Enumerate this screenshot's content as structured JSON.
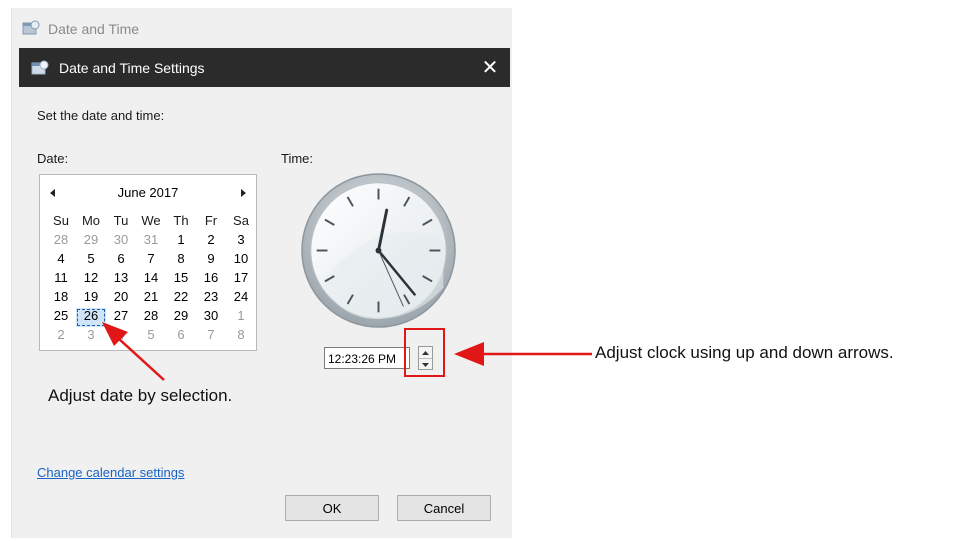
{
  "background_window": {
    "title": "Date and Time",
    "icon": "date-time-icon"
  },
  "dialog": {
    "title": "Date and Time Settings",
    "icon": "date-time-icon",
    "close_icon": "close-icon",
    "instruction": "Set the date and time:",
    "date_label": "Date:",
    "time_label": "Time:",
    "calendar": {
      "month_label": "June 2017",
      "weekdays": [
        "Su",
        "Mo",
        "Tu",
        "We",
        "Th",
        "Fr",
        "Sa"
      ],
      "weeks": [
        [
          "28",
          "29",
          "30",
          "31",
          "1",
          "2",
          "3"
        ],
        [
          "4",
          "5",
          "6",
          "7",
          "8",
          "9",
          "10"
        ],
        [
          "11",
          "12",
          "13",
          "14",
          "15",
          "16",
          "17"
        ],
        [
          "18",
          "19",
          "20",
          "21",
          "22",
          "23",
          "24"
        ],
        [
          "25",
          "26",
          "27",
          "28",
          "29",
          "30",
          "1"
        ],
        [
          "2",
          "3",
          "4",
          "5",
          "6",
          "7",
          "8"
        ]
      ],
      "selected_day": "26"
    },
    "clock": {
      "hour": 12,
      "minute": 23,
      "second": 26
    },
    "time_value": "12:23:26 PM",
    "change_calendar_link": "Change calendar settings",
    "ok_label": "OK",
    "cancel_label": "Cancel"
  },
  "annotations": {
    "date_note": "Adjust date by selection.",
    "clock_note": "Adjust clock using up and down arrows.",
    "arrow_color": "#e11616"
  }
}
